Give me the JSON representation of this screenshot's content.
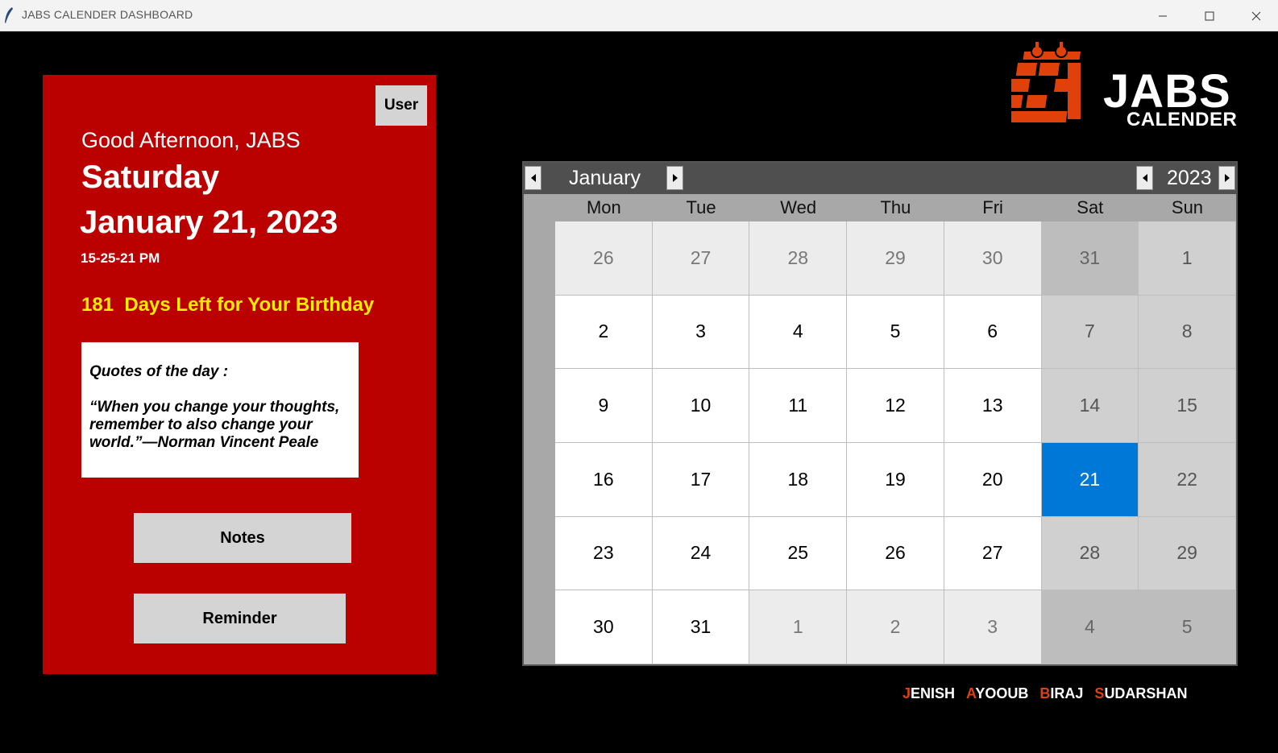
{
  "window": {
    "title": "JABS CALENDER DASHBOARD",
    "controls": [
      "minimize",
      "maximize",
      "close"
    ]
  },
  "panel": {
    "user_button": "User",
    "greeting": "Good Afternoon, JABS",
    "day_name": "Saturday",
    "date": "January 21, 2023",
    "time": "15-25-21 PM",
    "birthday_text": "181  Days Left for Your Birthday",
    "quote_title": "Quotes of the day :",
    "quote_text": "“When you change your thoughts, remember to also change your world.”—Norman Vincent Peale",
    "notes_button": "Notes",
    "reminder_button": "Reminder"
  },
  "logo": {
    "main": "JABS",
    "sub": "CALENDER"
  },
  "calendar": {
    "month": "January",
    "year": "2023",
    "weekdays": [
      "Mon",
      "Tue",
      "Wed",
      "Thu",
      "Fri",
      "Sat",
      "Sun"
    ],
    "selected_day": "21",
    "weeks": [
      [
        {
          "d": "26",
          "t": "other"
        },
        {
          "d": "27",
          "t": "other"
        },
        {
          "d": "28",
          "t": "other"
        },
        {
          "d": "29",
          "t": "other"
        },
        {
          "d": "30",
          "t": "other"
        },
        {
          "d": "31",
          "t": "weekend-other"
        },
        {
          "d": "1",
          "t": "weekend"
        }
      ],
      [
        {
          "d": "2",
          "t": "cur"
        },
        {
          "d": "3",
          "t": "cur"
        },
        {
          "d": "4",
          "t": "cur"
        },
        {
          "d": "5",
          "t": "cur"
        },
        {
          "d": "6",
          "t": "cur"
        },
        {
          "d": "7",
          "t": "weekend"
        },
        {
          "d": "8",
          "t": "weekend"
        }
      ],
      [
        {
          "d": "9",
          "t": "cur"
        },
        {
          "d": "10",
          "t": "cur"
        },
        {
          "d": "11",
          "t": "cur"
        },
        {
          "d": "12",
          "t": "cur"
        },
        {
          "d": "13",
          "t": "cur"
        },
        {
          "d": "14",
          "t": "weekend"
        },
        {
          "d": "15",
          "t": "weekend"
        }
      ],
      [
        {
          "d": "16",
          "t": "cur"
        },
        {
          "d": "17",
          "t": "cur"
        },
        {
          "d": "18",
          "t": "cur"
        },
        {
          "d": "19",
          "t": "cur"
        },
        {
          "d": "20",
          "t": "cur"
        },
        {
          "d": "21",
          "t": "selected"
        },
        {
          "d": "22",
          "t": "weekend"
        }
      ],
      [
        {
          "d": "23",
          "t": "cur"
        },
        {
          "d": "24",
          "t": "cur"
        },
        {
          "d": "25",
          "t": "cur"
        },
        {
          "d": "26",
          "t": "cur"
        },
        {
          "d": "27",
          "t": "cur"
        },
        {
          "d": "28",
          "t": "weekend"
        },
        {
          "d": "29",
          "t": "weekend"
        }
      ],
      [
        {
          "d": "30",
          "t": "cur"
        },
        {
          "d": "31",
          "t": "cur"
        },
        {
          "d": "1",
          "t": "other"
        },
        {
          "d": "2",
          "t": "other"
        },
        {
          "d": "3",
          "t": "other"
        },
        {
          "d": "4",
          "t": "weekend-other"
        },
        {
          "d": "5",
          "t": "weekend-other"
        }
      ]
    ]
  },
  "credits": [
    {
      "initial": "J",
      "rest": "ENISH"
    },
    {
      "initial": "A",
      "rest": "YOOUB"
    },
    {
      "initial": "B",
      "rest": "IRAJ"
    },
    {
      "initial": "S",
      "rest": "UDARSHAN"
    }
  ],
  "colors": {
    "panel_red": "#bb0000",
    "birthday_yellow": "#ffeb00",
    "selected_blue": "#0078d7",
    "accent_orange": "#e0400a"
  }
}
